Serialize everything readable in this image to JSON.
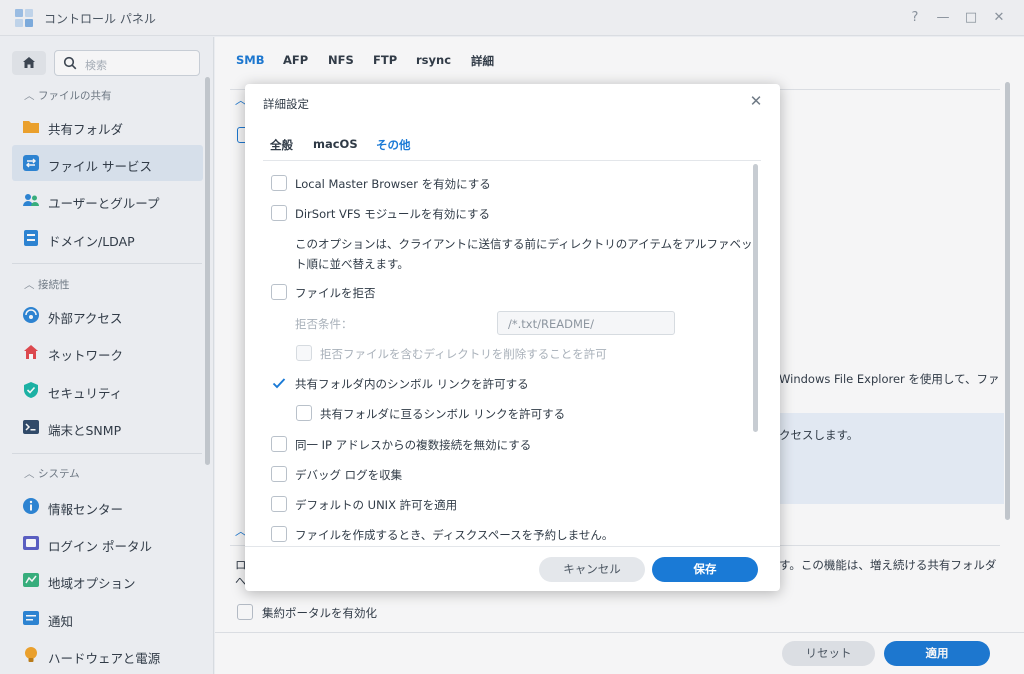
{
  "window": {
    "title": "コントロール パネル",
    "help": "?",
    "minimize": "—",
    "maximize": "□",
    "close": "✕"
  },
  "sidebar": {
    "search_placeholder": "検索",
    "sections": [
      {
        "label": "ファイルの共有",
        "items": [
          "共有フォルダ",
          "ファイル サービス",
          "ユーザーとグループ",
          "ドメイン/LDAP"
        ]
      },
      {
        "label": "接続性",
        "items": [
          "外部アクセス",
          "ネットワーク",
          "セキュリティ",
          "端末とSNMP"
        ]
      },
      {
        "label": "システム",
        "items": [
          "情報センター",
          "ログイン ポータル",
          "地域オプション",
          "通知",
          "ハードウェアと電源"
        ]
      }
    ],
    "active_item": "ファイル サービス"
  },
  "main": {
    "tabs": [
      "SMB",
      "AFP",
      "NFS",
      "FTP",
      "rsync",
      "詳細"
    ],
    "active_tab": "SMB",
    "bg_text_1": "Windows File Explorer を使用して、ファ",
    "bg_text_2": "クセスします。",
    "bg_text_3": "す。この機能は、増え続ける共有フォルダ",
    "bg_text_4": "ロ",
    "bg_text_5": "へ",
    "bg_checkbox_label": "集約ポータルを有効化",
    "reset_button": "リセット",
    "apply_button": "適用"
  },
  "dialog": {
    "title": "詳細設定",
    "close": "✕",
    "tabs": [
      "全般",
      "macOS",
      "その他"
    ],
    "active_tab": "その他",
    "options": {
      "local_master_browser": "Local Master Browser を有効にする",
      "dirsort_vfs": "DirSort VFS モジュールを有効にする",
      "dirsort_desc_1": "このオプションは、クライアントに送信する前にディレクトリのアイテムをアルファベッ",
      "dirsort_desc_2": "ト順に並べ替えます。",
      "deny_files": "ファイルを拒否",
      "deny_condition_label": "拒否条件：",
      "deny_condition_value": "/*.txt/README/",
      "allow_delete_dirs": "拒否ファイルを含むディレクトリを削除することを許可",
      "allow_symlinks": "共有フォルダ内のシンボル リンクを許可する",
      "allow_cross_symlinks": "共有フォルダに亘るシンボル リンクを許可する",
      "disable_multi_conn": "同一 IP アドレスからの複数接続を無効にする",
      "collect_debug_log": "デバッグ ログを収集",
      "apply_unix_perm": "デフォルトの UNIX 許可を適用",
      "no_reserve_space": "ファイルを作成するとき、ディスクスペースを予約しません。"
    },
    "cancel_button": "キャンセル",
    "save_button": "保存"
  },
  "colors": {
    "accent": "#1a7ad6",
    "sidebar_active": "#dfe8f3"
  }
}
